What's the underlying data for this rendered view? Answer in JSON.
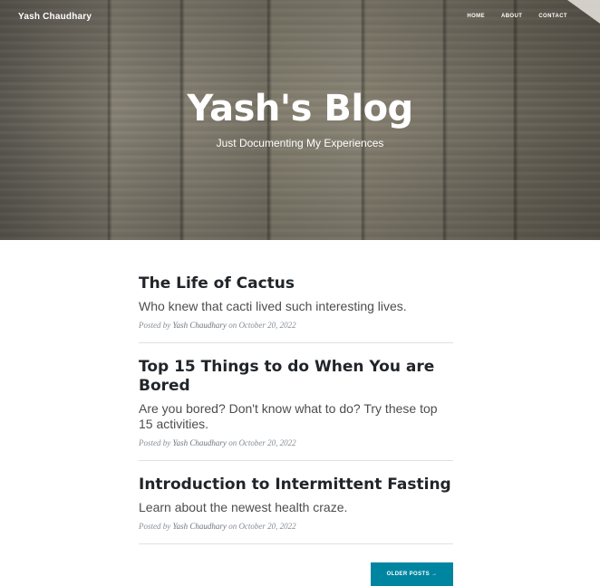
{
  "navbar": {
    "brand": "Yash Chaudhary",
    "links": [
      {
        "label": "HOME"
      },
      {
        "label": "ABOUT"
      },
      {
        "label": "CONTACT"
      }
    ]
  },
  "hero": {
    "title": "Yash's Blog",
    "subtitle": "Just Documenting My Experiences"
  },
  "posts": [
    {
      "title": "The Life of Cactus",
      "subtitle": "Who knew that cacti lived such interesting lives.",
      "meta_prefix": "Posted by",
      "author": "Yash Chaudhary",
      "meta_on": "on",
      "date": "October 20, 2022"
    },
    {
      "title": "Top 15 Things to do When You are Bored",
      "subtitle": "Are you bored? Don't know what to do? Try these top 15 activities.",
      "meta_prefix": "Posted by",
      "author": "Yash Chaudhary",
      "meta_on": "on",
      "date": "October 20, 2022"
    },
    {
      "title": "Introduction to Intermittent Fasting",
      "subtitle": "Learn about the newest health craze.",
      "meta_prefix": "Posted by",
      "author": "Yash Chaudhary",
      "meta_on": "on",
      "date": "October 20, 2022"
    }
  ],
  "pager": {
    "older_label": "OLDER POSTS →"
  },
  "colors": {
    "accent": "#0085a1",
    "heading": "#212529",
    "meta": "#868e96"
  }
}
